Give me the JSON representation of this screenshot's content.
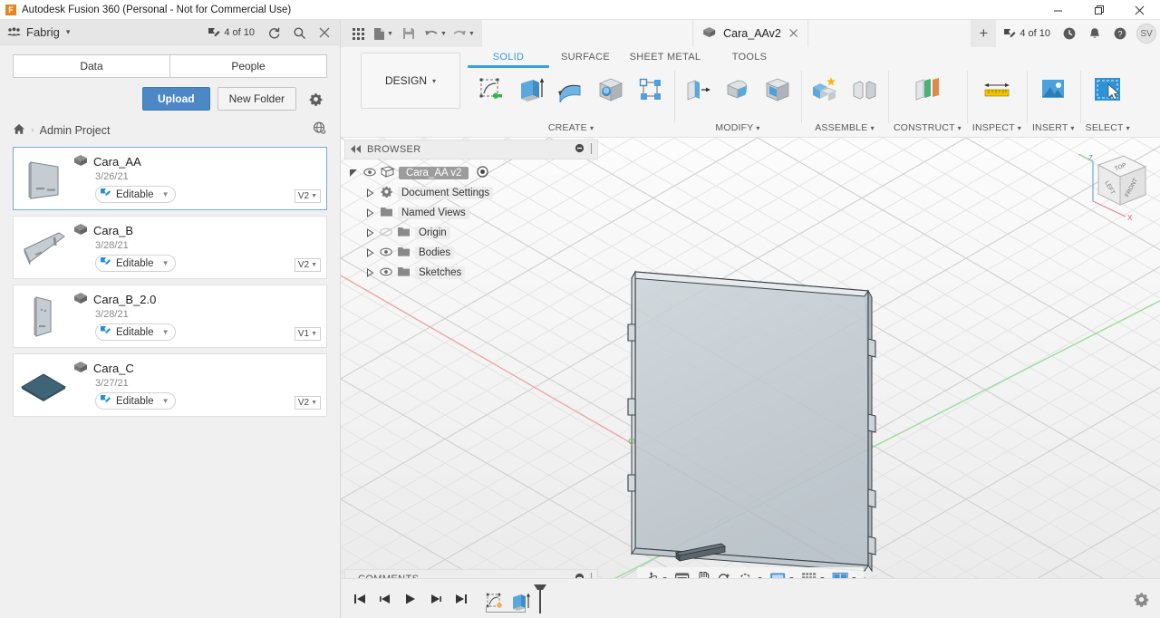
{
  "window": {
    "title": "Autodesk Fusion 360 (Personal - Not for Commercial Use)",
    "logo_letter": "F",
    "minimize_icon": "minimize-icon",
    "maximize_icon": "maximize-icon",
    "close_icon": "close-icon"
  },
  "data_panel": {
    "hub_name": "Fabrig",
    "hub_caret": "▾",
    "edit_count": "4 of 10",
    "refresh_icon": "refresh-icon",
    "search_icon": "search-icon",
    "close_icon": "close-icon",
    "tabs": [
      {
        "label": "Data",
        "active": true
      },
      {
        "label": "People",
        "active": false
      }
    ],
    "upload_label": "Upload",
    "new_folder_label": "New Folder",
    "settings_icon": "gear-icon",
    "breadcrumb": {
      "home_icon": "home-icon",
      "separator": "›",
      "project": "Admin Project",
      "globe_icon": "globe-share-icon"
    },
    "items": [
      {
        "name": "Cara_AA",
        "date": "3/26/21",
        "status": "Editable",
        "version": "V2",
        "selected": true,
        "thumb": "panel-light"
      },
      {
        "name": "Cara_B",
        "date": "3/28/21",
        "status": "Editable",
        "version": "V2",
        "selected": false,
        "thumb": "panel-wide"
      },
      {
        "name": "Cara_B_2.0",
        "date": "3/28/21",
        "status": "Editable",
        "version": "V1",
        "selected": false,
        "thumb": "panel-tall"
      },
      {
        "name": "Cara_C",
        "date": "3/27/21",
        "status": "Editable",
        "version": "V2",
        "selected": false,
        "thumb": "panel-dark"
      }
    ]
  },
  "quick_access": {
    "grid_icon": "app-grid-icon",
    "file_icon": "file-icon",
    "save_icon": "save-icon",
    "undo_icon": "undo-icon",
    "redo_icon": "redo-icon",
    "caret": "▾",
    "document_tab": {
      "label": "Cara_AAv2",
      "doc_icon": "document-cube-icon",
      "close_icon": "close-icon"
    },
    "new_tab_label": "+",
    "edit_count": "4 of 10",
    "job_status_icon": "job-status-clock-icon",
    "notifications_icon": "bell-icon",
    "help_icon": "help-icon",
    "avatar_initials": "SV"
  },
  "ribbon": {
    "workspace_label": "DESIGN",
    "workspace_caret": "▾",
    "tabs": [
      {
        "label": "SOLID",
        "active": true
      },
      {
        "label": "SURFACE",
        "active": false
      },
      {
        "label": "SHEET METAL",
        "active": false
      },
      {
        "label": "TOOLS",
        "active": false
      }
    ],
    "panels": [
      {
        "label": "CREATE",
        "caret": "▾",
        "commands": [
          "create-sketch-icon",
          "extrude-icon",
          "sweep-icon",
          "hole-icon",
          "pattern-icon"
        ]
      },
      {
        "label": "MODIFY",
        "caret": "▾",
        "commands": [
          "press-pull-icon",
          "fillet-icon",
          "shell-icon"
        ]
      },
      {
        "label": "ASSEMBLE",
        "caret": "▾",
        "commands": [
          "new-component-icon",
          "joint-icon"
        ]
      },
      {
        "label": "CONSTRUCT",
        "caret": "▾",
        "commands": [
          "offset-plane-icon"
        ]
      },
      {
        "label": "INSPECT",
        "caret": "▾",
        "commands": [
          "measure-icon"
        ]
      },
      {
        "label": "INSERT",
        "caret": "▾",
        "commands": [
          "insert-image-icon"
        ]
      },
      {
        "label": "SELECT",
        "caret": "▾",
        "commands": [
          "select-window-icon"
        ]
      }
    ]
  },
  "browser": {
    "title": "BROWSER",
    "collapse_icon": "collapse-left-icon",
    "minimize_icon": "panel-minimize-icon",
    "grip_icon": "panel-grip-icon",
    "nodes": [
      {
        "label": "Cara_AA v2",
        "icon": "component-icon",
        "eye": "visible",
        "root": true,
        "indent": 0
      },
      {
        "label": "Document Settings",
        "icon": "gear-icon",
        "eye": "none",
        "root": false,
        "indent": 1
      },
      {
        "label": "Named Views",
        "icon": "folder-icon",
        "eye": "none",
        "root": false,
        "indent": 1
      },
      {
        "label": "Origin",
        "icon": "folder-icon",
        "eye": "hidden",
        "root": false,
        "indent": 1
      },
      {
        "label": "Bodies",
        "icon": "folder-icon",
        "eye": "visible",
        "root": false,
        "indent": 1
      },
      {
        "label": "Sketches",
        "icon": "folder-icon",
        "eye": "visible",
        "root": false,
        "indent": 1
      }
    ]
  },
  "comments": {
    "title": "COMMENTS",
    "minimize_icon": "panel-minimize-icon",
    "grip_icon": "panel-grip-icon"
  },
  "nav_bar": {
    "items": [
      {
        "icon": "orbit-icon",
        "caret": true
      },
      {
        "icon": "look-at-icon",
        "caret": false
      },
      {
        "icon": "pan-icon",
        "caret": false
      },
      {
        "icon": "zoom-icon",
        "caret": false
      },
      {
        "icon": "fit-icon",
        "caret": true
      },
      {
        "icon": "display-settings-icon",
        "caret": true
      },
      {
        "icon": "grid-snaps-icon",
        "caret": true
      },
      {
        "icon": "viewports-icon",
        "caret": true
      }
    ]
  },
  "timeline": {
    "controls": [
      "go-to-beginning-icon",
      "step-back-icon",
      "play-icon",
      "step-forward-icon",
      "go-to-end-icon"
    ],
    "features": [
      "sketch-feature-icon",
      "extrude-feature-icon"
    ],
    "marker_icon": "timeline-marker-icon",
    "settings_icon": "gear-icon"
  },
  "viewcube": {
    "top_label": "TOP",
    "left_label": "LEFT",
    "front_label": "FRONT",
    "axis_z": "Z",
    "axis_x": "X"
  },
  "colors": {
    "accent_blue": "#4c87c6",
    "tab_active": "#36a0e0",
    "model_face": "#c3ccd2",
    "model_edge": "#2f3a40",
    "axis_red": "#e8a0a0",
    "axis_green": "#86d186",
    "upload_button": "#4c87c6"
  }
}
